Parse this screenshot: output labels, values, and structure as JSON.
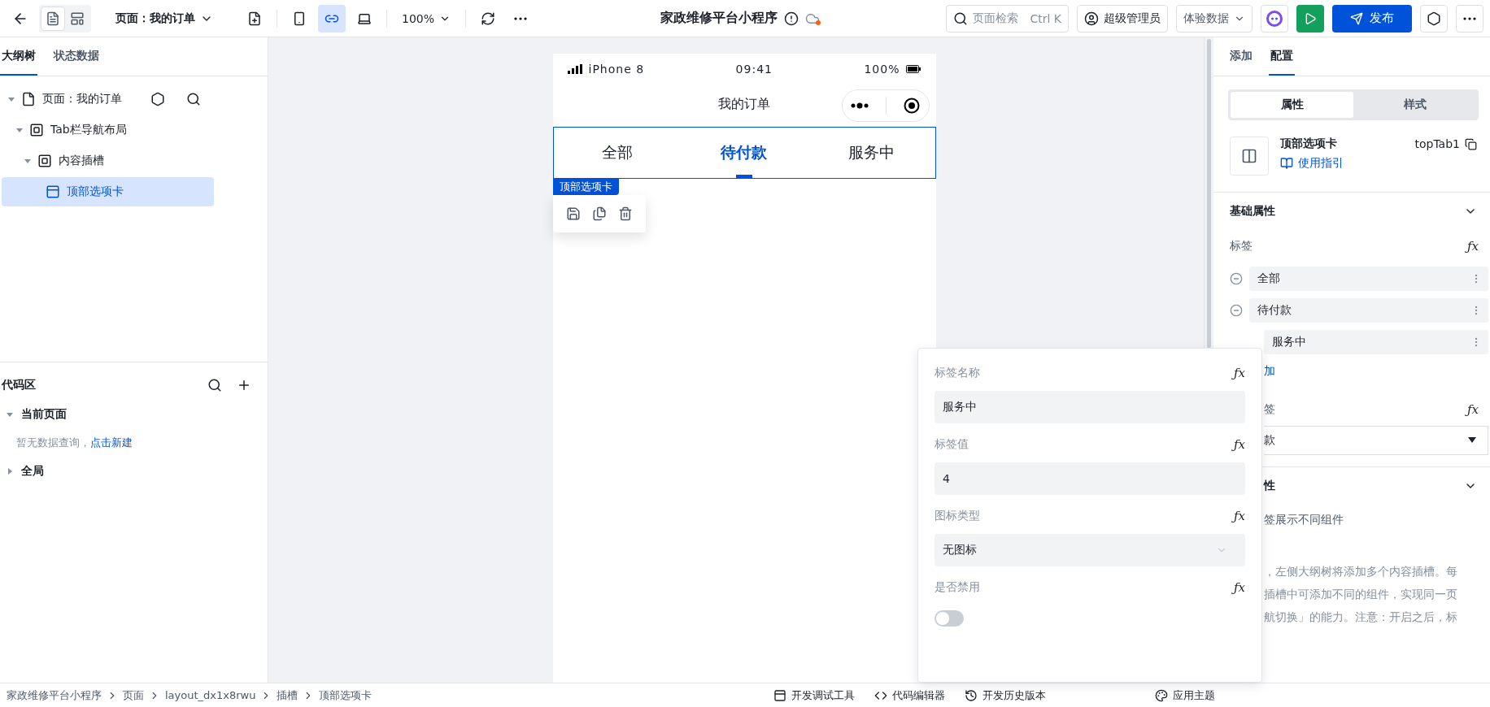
{
  "topbar": {
    "view_modes": [
      {
        "selected": true
      },
      {
        "selected": false
      }
    ],
    "page_selector": "页面：我的订单",
    "devices": [
      {
        "kind": "phone",
        "selected": false
      },
      {
        "kind": "miniprogram",
        "selected": true
      },
      {
        "kind": "desktop",
        "selected": false
      }
    ],
    "zoom": "100%",
    "title": "家政维修平台小程序",
    "search": {
      "placeholder": "页面检索",
      "shortcut": "Ctrl K"
    },
    "user": "超级管理员",
    "data_mode": "体验数据",
    "publish": "发布"
  },
  "left_panel": {
    "tabs": [
      {
        "label": "大纲树",
        "selected": true
      },
      {
        "label": "状态数据",
        "selected": false
      }
    ],
    "tree": [
      {
        "label": "页面：我的订单",
        "expanded": true,
        "selected": false,
        "children": [
          {
            "label": "Tab栏导航布局",
            "expanded": true,
            "selected": false,
            "children": [
              {
                "label": "内容插槽",
                "expanded": true,
                "selected": false,
                "children": [
                  {
                    "label": "顶部选项卡",
                    "selected": true
                  }
                ]
              }
            ]
          }
        ]
      }
    ],
    "code_area": {
      "title": "代码区",
      "groups": [
        {
          "label": "当前页面",
          "expanded": true,
          "empty_text": "暂无数据查询，",
          "link": "点击新建"
        },
        {
          "label": "全局",
          "expanded": false
        }
      ]
    }
  },
  "phone": {
    "device": "iPhone 8",
    "time": "09:41",
    "battery": "100%",
    "nav_title": "我的订单",
    "tabs": [
      {
        "label": "全部",
        "selected": false
      },
      {
        "label": "待付款",
        "selected": true
      },
      {
        "label": "服务中",
        "selected": false
      }
    ],
    "selection_label": "顶部选项卡"
  },
  "right_panel": {
    "tabs": [
      {
        "label": "添加",
        "selected": false
      },
      {
        "label": "配置",
        "selected": true
      }
    ],
    "segments": [
      {
        "label": "属性",
        "selected": true
      },
      {
        "label": "样式",
        "selected": false
      }
    ],
    "component": {
      "name": "顶部选项卡",
      "id": "topTab1",
      "guide": "使用指引"
    },
    "basic_section": "基础属性",
    "tags_label": "标签",
    "tags_fx": "ƒx",
    "tag_rows": [
      {
        "label": "全部",
        "covered": false
      },
      {
        "label": "待付款",
        "covered": false
      },
      {
        "label": "服务中",
        "covered": true
      }
    ],
    "add_link": "加",
    "default_label": "签",
    "default_fx": "ƒx",
    "default_value": "款",
    "advanced_section": "性",
    "advanced_hint": "签展示不同组件",
    "note_lines": [
      "，左侧大纲树将添加多个内容插槽。每",
      "插槽中可添加不同的组件，实现同一页",
      "航切换」的能力。注意：开启之后，标"
    ]
  },
  "popup": {
    "fields": [
      {
        "kind": "input",
        "label": "标签名称",
        "fx": "ƒx",
        "value": "服务中"
      },
      {
        "kind": "input",
        "label": "标签值",
        "fx": "ƒx",
        "value": "4"
      },
      {
        "kind": "select",
        "label": "图标类型",
        "fx": "ƒx",
        "value": "无图标"
      },
      {
        "kind": "switch",
        "label": "是否禁用",
        "fx": "ƒx",
        "on": false
      }
    ]
  },
  "status_bar": {
    "breadcrumb": [
      "家政维修平台小程序",
      "页面",
      "layout_dx1x8rwu",
      "插槽",
      "顶部选项卡"
    ],
    "tools": [
      {
        "kind": "debug",
        "label": "开发调试工具"
      },
      {
        "kind": "code",
        "label": "代码编辑器"
      },
      {
        "kind": "history",
        "label": "开发历史版本"
      }
    ],
    "theme": "应用主题"
  }
}
